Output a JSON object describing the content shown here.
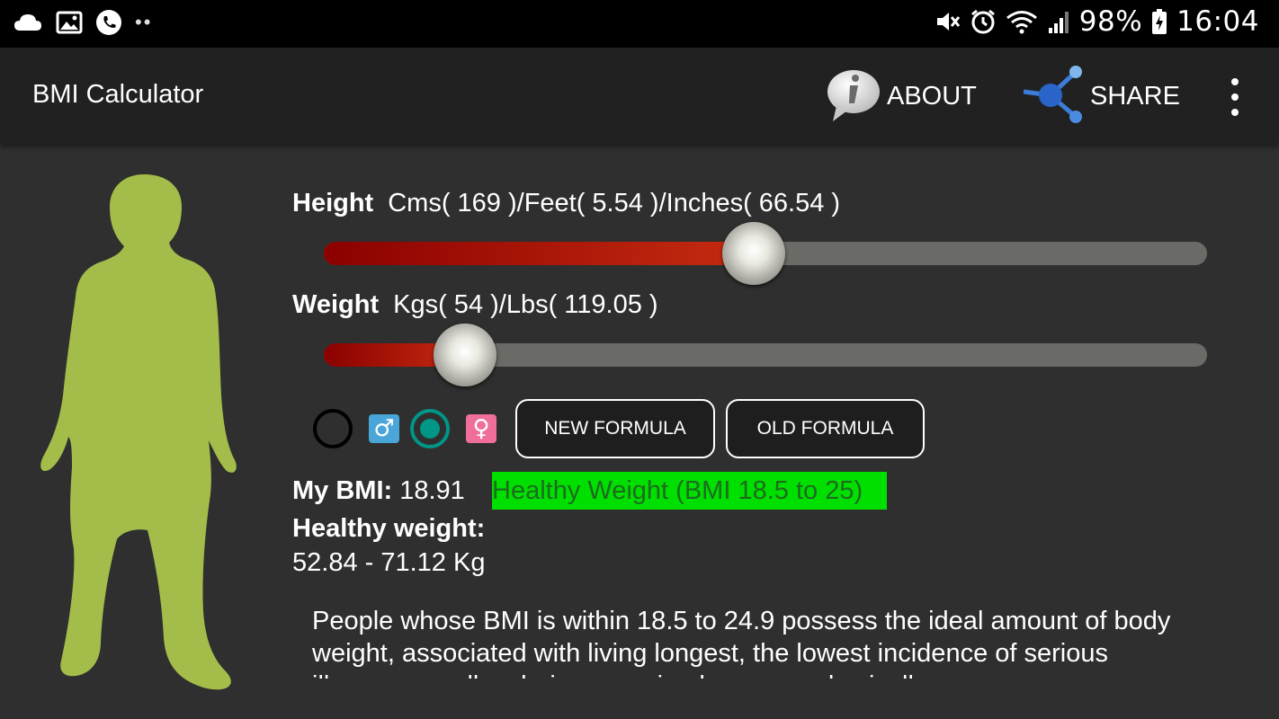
{
  "status_bar": {
    "left_icons": [
      "cloud-icon",
      "image-icon",
      "phone-icon"
    ],
    "dots": "••",
    "right_icons": [
      "mute-icon",
      "alarm-icon",
      "wifi-icon",
      "signal-icon"
    ],
    "battery": "98%",
    "time": "16:04"
  },
  "app_bar": {
    "title": "BMI Calculator",
    "about_label": "ABOUT",
    "share_label": "SHARE"
  },
  "height": {
    "label": "Height",
    "value_text": "Cms( 169 )/Feet( 5.54 )/Inches( 66.54 )",
    "slider_fraction": 0.487
  },
  "weight": {
    "label": "Weight",
    "value_text": "Kgs( 54 )/Lbs( 119.05 )",
    "slider_fraction": 0.16
  },
  "gender": {
    "male_symbol": "♂",
    "female_symbol": "♀",
    "selected": "female"
  },
  "formula_buttons": {
    "new_label": "NEW FORMULA",
    "old_label": "OLD FORMULA"
  },
  "result": {
    "bmi_label": "My BMI:",
    "bmi_value": "18.91",
    "category": "Healthy Weight (BMI 18.5 to 25)",
    "category_color": "#00e000",
    "healthy_weight_label": "Healthy weight:",
    "healthy_weight_range": "52.84 - 71.12 Kg"
  },
  "description": "People whose BMI is within 18.5 to 24.9 possess the ideal amount of body weight, associated with living longest, the lowest incidence of serious illness, as well as being perceived as more physically",
  "colors": {
    "figure": "#a4bd4a",
    "slider_fill": "#b2200c",
    "accent": "#009688"
  }
}
